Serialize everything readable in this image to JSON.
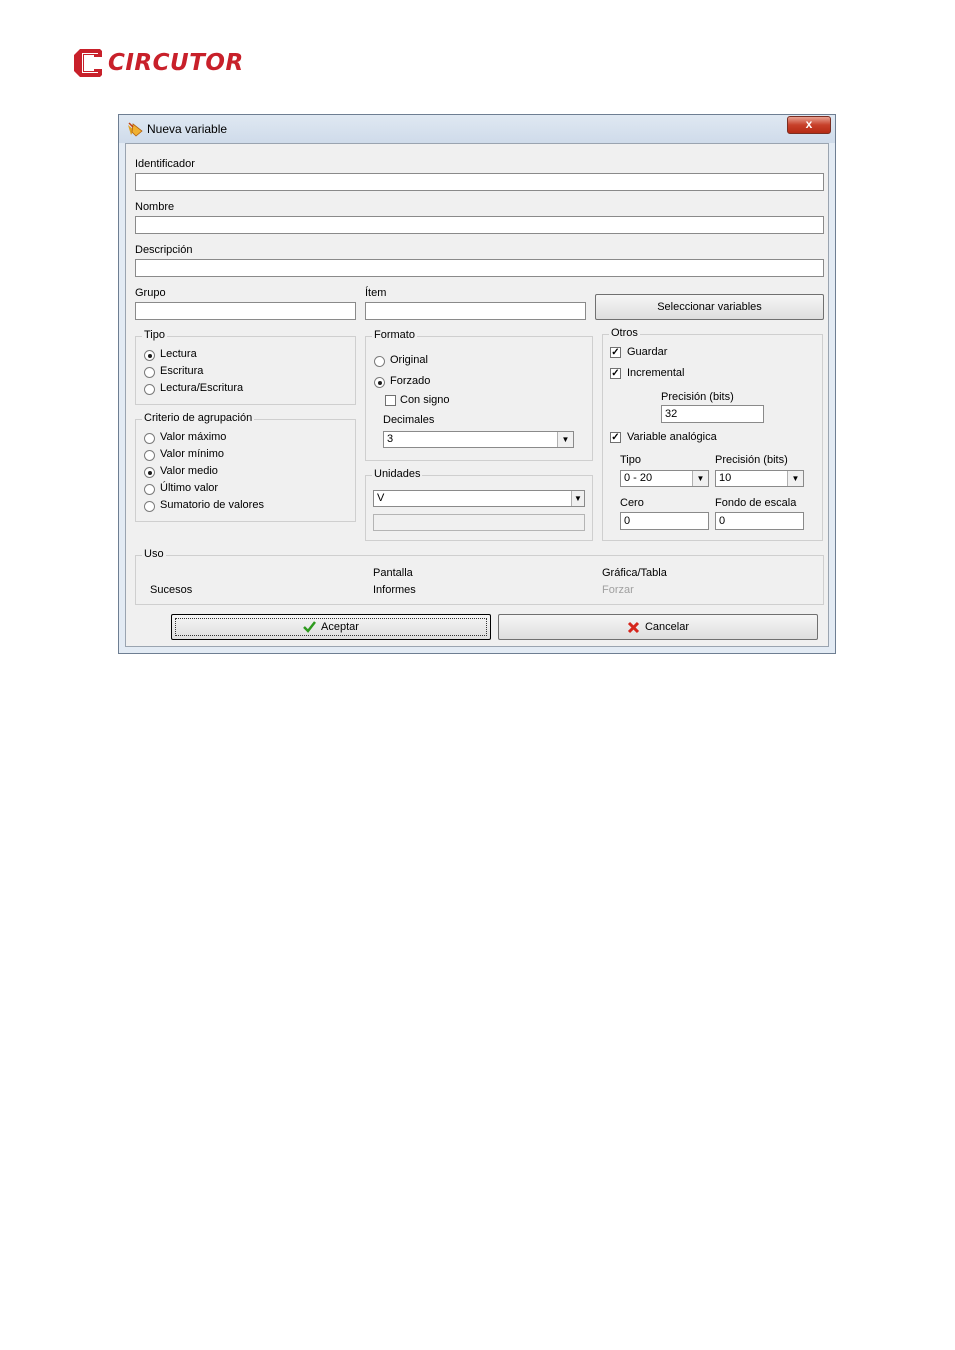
{
  "logo": {
    "text": "CIRCUTOR",
    "color": "#c8202a"
  },
  "window": {
    "title": "Nueva variable",
    "close": "x"
  },
  "fields": {
    "identificador": {
      "label": "Identificador",
      "value": ""
    },
    "nombre": {
      "label": "Nombre",
      "value": ""
    },
    "descripcion": {
      "label": "Descripción",
      "value": ""
    },
    "grupo": {
      "label": "Grupo",
      "value": ""
    },
    "item": {
      "label": "Ítem",
      "value": ""
    }
  },
  "seleccionar_button": "Seleccionar variables",
  "tipo": {
    "title": "Tipo",
    "options": [
      "Lectura",
      "Escritura",
      "Lectura/Escritura"
    ],
    "selected": "Lectura"
  },
  "criterio": {
    "title": "Criterio de agrupación",
    "options": [
      "Valor máximo",
      "Valor mínimo",
      "Valor medio",
      "Último valor",
      "Sumatorio de valores"
    ],
    "selected": "Valor medio"
  },
  "formato": {
    "title": "Formato",
    "original": "Original",
    "forzado": "Forzado",
    "selected": "Forzado",
    "con_signo": "Con signo",
    "con_signo_checked": false,
    "decimales_label": "Decimales",
    "decimales_value": "3"
  },
  "unidades": {
    "title": "Unidades",
    "value": "V",
    "extra": ""
  },
  "otros": {
    "title": "Otros",
    "guardar": "Guardar",
    "guardar_checked": true,
    "incremental": "Incremental",
    "incremental_checked": true,
    "precision_label": "Precisión (bits)",
    "precision_value": "32",
    "analogica": "Variable analógica",
    "analogica_checked": true,
    "tipo_label": "Tipo",
    "tipo_value": "0 - 20",
    "precision2_label": "Precisión (bits)",
    "precision2_value": "10",
    "cero_label": "Cero",
    "cero_value": "0",
    "fondo_label": "Fondo de escala",
    "fondo_value": "0"
  },
  "uso": {
    "title": "Uso",
    "pantalla": "Pantalla",
    "grafica": "Gráfica/Tabla",
    "sucesos": "Sucesos",
    "informes": "Informes",
    "forzar": "Forzar"
  },
  "buttons": {
    "aceptar": "Aceptar",
    "cancelar": "Cancelar"
  },
  "colors": {
    "accept_icon": "#2e9a1e",
    "cancel_icon": "#d6261c",
    "dialog_bg": "#f0f0f0"
  }
}
